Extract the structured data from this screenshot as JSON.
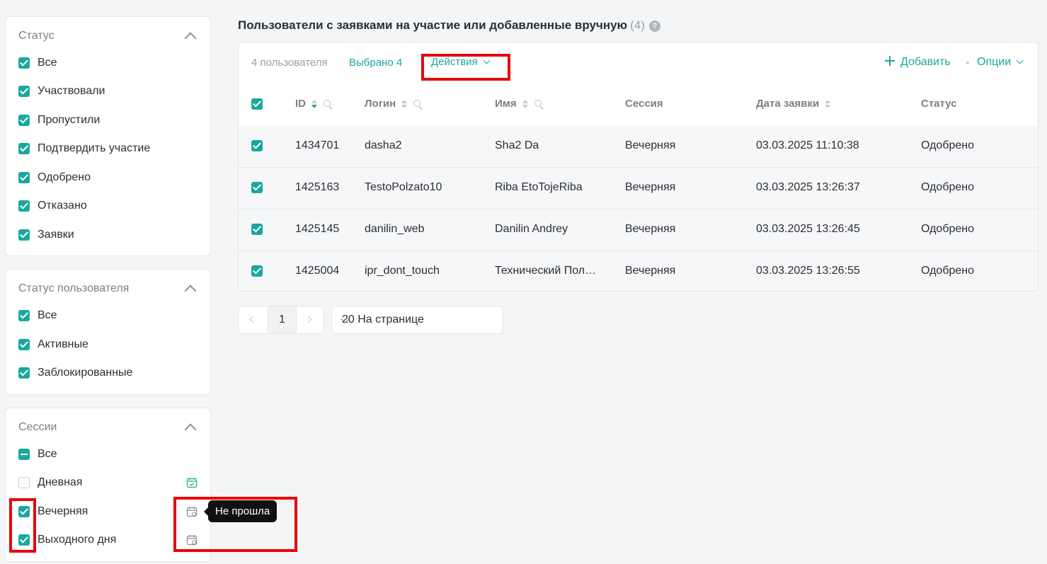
{
  "filters": {
    "status": {
      "title": "Статус",
      "items": [
        {
          "label": "Все",
          "state": "checked"
        },
        {
          "label": "Участвовали",
          "state": "checked"
        },
        {
          "label": "Пропустили",
          "state": "checked"
        },
        {
          "label": "Подтвердить участие",
          "state": "checked"
        },
        {
          "label": "Одобрено",
          "state": "checked"
        },
        {
          "label": "Отказано",
          "state": "checked"
        },
        {
          "label": "Заявки",
          "state": "checked"
        }
      ]
    },
    "user_status": {
      "title": "Статус пользователя",
      "items": [
        {
          "label": "Все",
          "state": "checked"
        },
        {
          "label": "Активные",
          "state": "checked"
        },
        {
          "label": "Заблокированные",
          "state": "checked"
        }
      ]
    },
    "sessions": {
      "title": "Сессии",
      "items": [
        {
          "label": "Все",
          "state": "indeterminate"
        },
        {
          "label": "Дневная",
          "state": "unchecked",
          "icon": "calendar-check-icon",
          "icon_color": "#2fb36b"
        },
        {
          "label": "Вечерняя",
          "state": "checked",
          "icon": "calendar-clock-icon",
          "icon_color": "#8b9096"
        },
        {
          "label": "Выходного дня",
          "state": "checked",
          "icon": "calendar-clock-icon",
          "icon_color": "#8b9096"
        }
      ]
    }
  },
  "main": {
    "title": "Пользователи с заявками на участие или добавленные вручную",
    "count": "(4)",
    "help_icon": "?",
    "toolbar": {
      "user_count": "4 пользователя",
      "selected": "Выбрано 4",
      "actions": "Действия",
      "add": "Добавить",
      "options": "Опции"
    },
    "table": {
      "headers": [
        "ID",
        "Логин",
        "Имя",
        "Сессия",
        "Дата заявки",
        "Статус"
      ],
      "rows": [
        {
          "id": "1434701",
          "login": "dasha2",
          "name": "Sha2 Da",
          "session": "Вечерняя",
          "date": "03.03.2025 11:10:38",
          "status": "Одобрено"
        },
        {
          "id": "1425163",
          "login": "TestoPolzato10",
          "name": "Riba EtoTojeRiba",
          "session": "Вечерняя",
          "date": "03.03.2025 13:26:37",
          "status": "Одобрено"
        },
        {
          "id": "1425145",
          "login": "danilin_web",
          "name": "Danilin Andrey",
          "session": "Вечерняя",
          "date": "03.03.2025 13:26:45",
          "status": "Одобрено"
        },
        {
          "id": "1425004",
          "login": "ipr_dont_touch",
          "name": "Технический Пользователь",
          "session": "Вечерняя",
          "date": "03.03.2025 13:26:55",
          "status": "Одобрено"
        }
      ]
    },
    "pagination": {
      "page": "1",
      "per_page": "20 На странице"
    }
  },
  "tooltip": "Не прошла",
  "colors": {
    "accent": "#1aa89d",
    "highlight": "#e8060a"
  }
}
